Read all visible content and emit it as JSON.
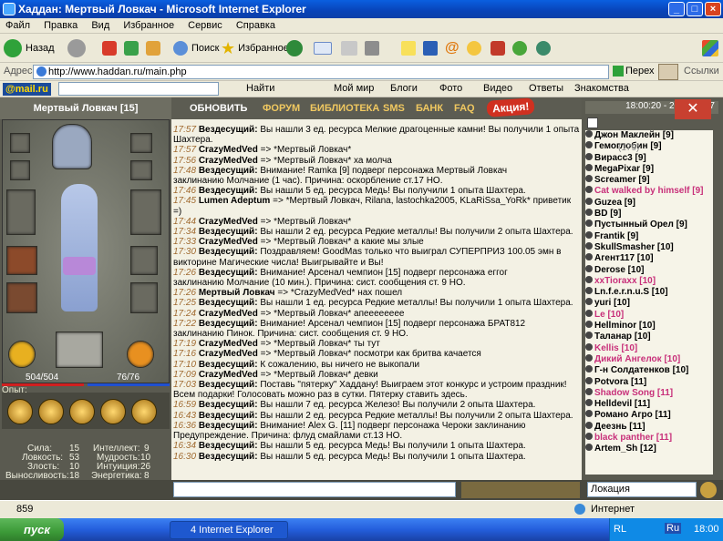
{
  "window": {
    "title": "Хаддан: Мертвый Ловкач - Microsoft Internet Explorer"
  },
  "menu": [
    "Файл",
    "Правка",
    "Вид",
    "Избранное",
    "Сервис",
    "Справка"
  ],
  "toolbar": {
    "back": "Назад",
    "search": "Поиск",
    "favorites": "Избранное"
  },
  "address": {
    "label": "Адрес:",
    "url": "http://www.haddan.ru/main.php",
    "go": "Перех",
    "links": "Ссылки"
  },
  "mailbar": {
    "logo": "@mail.ru",
    "find": "Найти",
    "items": [
      "Мой мир",
      "Блоги",
      "Фото",
      "Видео",
      "Ответы",
      "Знакомства"
    ]
  },
  "game": {
    "character": "Мертвый Ловкач [15]",
    "hp": "504/504",
    "mana": "76/76",
    "exp_label": "Опыт:",
    "stats": [
      {
        "label": "Сила:",
        "value": "15"
      },
      {
        "label": "Ловкость:",
        "value": "53"
      },
      {
        "label": "Злость:",
        "value": "10"
      },
      {
        "label": "Выносливость:",
        "value": "18"
      },
      {
        "label": "Интеллект:",
        "value": "9"
      },
      {
        "label": "Мудрость:",
        "value": "10"
      },
      {
        "label": "Интуиция:",
        "value": "26"
      },
      {
        "label": "Энергетика:",
        "value": "8"
      }
    ],
    "money": "0 мн",
    "money2": "23.88 эмн / 0.14 амн",
    "nav": [
      "ОБНОВИТЬ",
      "ФОРУМ",
      "БИБЛИОТЕКА",
      "SMS",
      "БАНК",
      "FAQ"
    ],
    "promo": "Акция!",
    "datetime": "18:00:20 - 20/12/2007",
    "roster_count": "(179)",
    "location": "Локация"
  },
  "chat": [
    {
      "t": "17:57",
      "n": "Вездесущий:",
      "m": "Вы нашли 3 ед. ресурса Мелкие драгоценные камни! Вы получили 1 опыта"
    },
    {
      "t": "",
      "n": "",
      "m": "Шахтера."
    },
    {
      "t": "17:57",
      "n": "CrazyMedVed",
      "m": "=> *Мертвый Ловкач*"
    },
    {
      "t": "17:56",
      "n": "CrazyMedVed",
      "m": "=> *Мертвый Ловкач*  ха молча"
    },
    {
      "t": "17:48",
      "n": "Вездесущий:",
      "m": "Внимание! Ramka [9] подверг персонажа Мертвый Ловкач"
    },
    {
      "t": "",
      "n": "",
      "m": "заклинанию Молчание (1 час). Причина: оскорбление ст.17 НО."
    },
    {
      "t": "17:46",
      "n": "Вездесущий:",
      "m": "Вы нашли 5 ед. ресурса Медь! Вы получили 1 опыта Шахтера."
    },
    {
      "t": "17:45",
      "n": "Lumen Adeptum",
      "m": "=> *Мертвый Ловкач, Rilana, lastochka2005, KLaRiSsa_YoRk*  приветик"
    },
    {
      "t": "",
      "n": "",
      "m": "=)"
    },
    {
      "t": "17:44",
      "n": "CrazyMedVed",
      "m": "=> *Мертвый Ловкач*"
    },
    {
      "t": "17:34",
      "n": "Вездесущий:",
      "m": "Вы нашли 2 ед. ресурса Редкие металлы! Вы получили 2 опыта Шахтера."
    },
    {
      "t": "17:33",
      "n": "CrazyMedVed",
      "m": "=> *Мертвый Ловкач*  а какие мы злые"
    },
    {
      "t": "17:30",
      "n": "Вездесущий:",
      "m": "Поздравляем! GoodMas только что выиграл СУПЕРПРИЗ 100.05 эмн в"
    },
    {
      "t": "",
      "n": "",
      "m": "викторине Магические числа! Выигрывайте и Вы!"
    },
    {
      "t": "17:26",
      "n": "Вездесущий:",
      "m": "Внимание! Арсенал чемпион [15] подверг персонажа еггог"
    },
    {
      "t": "",
      "n": "",
      "m": "заклинанию Молчание (10 мин.). Причина: сист. сообщения ст. 9 НО."
    },
    {
      "t": "17:26",
      "n": "Мертвый Ловкач",
      "m": "=> *CrazyMedVed*  нах пошел"
    },
    {
      "t": "17:25",
      "n": "Вездесущий:",
      "m": "Вы нашли 1 ед. ресурса Редкие металлы! Вы получили 1 опыта Шахтера."
    },
    {
      "t": "17:24",
      "n": "CrazyMedVed",
      "m": "=> *Мертвый Ловкач*  апееееееее"
    },
    {
      "t": "17:22",
      "n": "Вездесущий:",
      "m": "Внимание! Арсенал чемпион [15] подверг персонажа БРАТ812"
    },
    {
      "t": "",
      "n": "",
      "m": "заклинанию Пинок. Причина: сист. сообщения ст. 9 НО."
    },
    {
      "t": "17:19",
      "n": "CrazyMedVed",
      "m": "=> *Мертвый Ловкач*  ты тут"
    },
    {
      "t": "17:16",
      "n": "CrazyMedVed",
      "m": "=> *Мертвый Ловкач*  посмотри как бритва качается"
    },
    {
      "t": "17:10",
      "n": "Вездесущий:",
      "m": "К сожалению, вы ничего не выкопали"
    },
    {
      "t": "17:09",
      "n": "CrazyMedVed",
      "m": "=> *Мертвый Ловкач*  девки"
    },
    {
      "t": "17:03",
      "n": "Вездесущий:",
      "m": "Поставь \"пятерку\" Хаддану! Выиграем этот конкурс и устроим праздник!"
    },
    {
      "t": "",
      "n": "",
      "m": "Всем подарки! Голосовать можно раз в сутки. Пятерку ставить здесь."
    },
    {
      "t": "16:59",
      "n": "Вездесущий:",
      "m": "Вы нашли 7 ед. ресурса Железо! Вы получили 2 опыта Шахтера."
    },
    {
      "t": "16:43",
      "n": "Вездесущий:",
      "m": "Вы нашли 2 ед. ресурса Редкие металлы! Вы получили 2 опыта Шахтера."
    },
    {
      "t": "16:36",
      "n": "Вездесущий:",
      "m": "Внимание! Alex G. [11] подверг персонажа Чероки заклинанию"
    },
    {
      "t": "",
      "n": "",
      "m": "Предупреждение. Причина: флуд смайлами ст.13 НО."
    },
    {
      "t": "16:34",
      "n": "Вездесущий:",
      "m": "Вы нашли 5 ед. ресурса Медь! Вы получили 1 опыта Шахтера."
    },
    {
      "t": "16:30",
      "n": "Вездесущий:",
      "m": "Вы нашли 5 ед. ресурса Медь! Вы получили 1 опыта Шахтера."
    }
  ],
  "roster": [
    {
      "name": "Джон Маклейн [9]",
      "pink": false
    },
    {
      "name": "Гемоглобин [9]",
      "pink": false
    },
    {
      "name": "Вирасс3 [9]",
      "pink": false
    },
    {
      "name": "MegaPixar [9]",
      "pink": false
    },
    {
      "name": "Screamer [9]",
      "pink": false
    },
    {
      "name": "Cat walked by himself [9]",
      "pink": true
    },
    {
      "name": "Guzea [9]",
      "pink": false
    },
    {
      "name": "BD [9]",
      "pink": false
    },
    {
      "name": "Пустынный Орел [9]",
      "pink": false
    },
    {
      "name": "Frantik [9]",
      "pink": false
    },
    {
      "name": "SkullSmasher [10]",
      "pink": false
    },
    {
      "name": "Агент117 [10]",
      "pink": false
    },
    {
      "name": "Derose [10]",
      "pink": false
    },
    {
      "name": "xxTioraxx [10]",
      "pink": true
    },
    {
      "name": "Ln.f.e.r.n.u.S [10]",
      "pink": false
    },
    {
      "name": "yuri [10]",
      "pink": false
    },
    {
      "name": "Le [10]",
      "pink": true
    },
    {
      "name": "Hellminor [10]",
      "pink": false
    },
    {
      "name": "Таланар [10]",
      "pink": false
    },
    {
      "name": "Kellis [10]",
      "pink": true
    },
    {
      "name": "Дикий Ангелок [10]",
      "pink": true
    },
    {
      "name": "Г-н Солдатенков [10]",
      "pink": false
    },
    {
      "name": "Potvora [11]",
      "pink": false
    },
    {
      "name": "Shadow Song [11]",
      "pink": true
    },
    {
      "name": "Helldevil [11]",
      "pink": false
    },
    {
      "name": "Романо Агро [11]",
      "pink": false
    },
    {
      "name": "Деезнь [11]",
      "pink": false
    },
    {
      "name": "black panther [11]",
      "pink": true
    },
    {
      "name": "Artem_Sh [12]",
      "pink": false
    }
  ],
  "status": {
    "count": "859",
    "zone": "Интернет"
  },
  "taskbar": {
    "start": "пуск",
    "task": "4 Internet Explorer",
    "lang": "RL",
    "lang2": "Ru",
    "clock": "18:00"
  }
}
